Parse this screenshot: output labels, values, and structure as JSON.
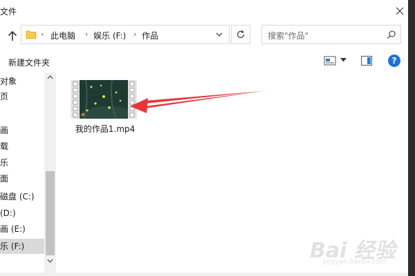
{
  "window": {
    "title": "文件"
  },
  "address_bar": {
    "crumbs": [
      "此电脑",
      "娱乐 (F:)",
      "作品"
    ],
    "separator": "›"
  },
  "search": {
    "placeholder": "搜索\"作品\""
  },
  "toolbar": {
    "new_folder": "新建文件夹",
    "help": "?"
  },
  "sidebar": {
    "items": [
      {
        "label": "对象"
      },
      {
        "label": "页"
      },
      {
        "label": ""
      },
      {
        "label": "画"
      },
      {
        "label": "载"
      },
      {
        "label": "乐"
      },
      {
        "label": "面"
      },
      {
        "label": "磁盘 (C:)"
      },
      {
        "label": "(D:)"
      },
      {
        "label": "画 (E:)"
      },
      {
        "label": "乐 (F:)",
        "selected": true
      }
    ]
  },
  "files": [
    {
      "name": "我的作品1.mp4",
      "type": "video",
      "icon": "video-thumbnail"
    }
  ],
  "watermark": {
    "text": "Bai 经验",
    "url": "jingyan.baidu.com"
  },
  "colors": {
    "accent": "#1e72d8",
    "arrow": "#e8353a",
    "selected": "#d9d9d9",
    "folder": "#f4c94f"
  }
}
